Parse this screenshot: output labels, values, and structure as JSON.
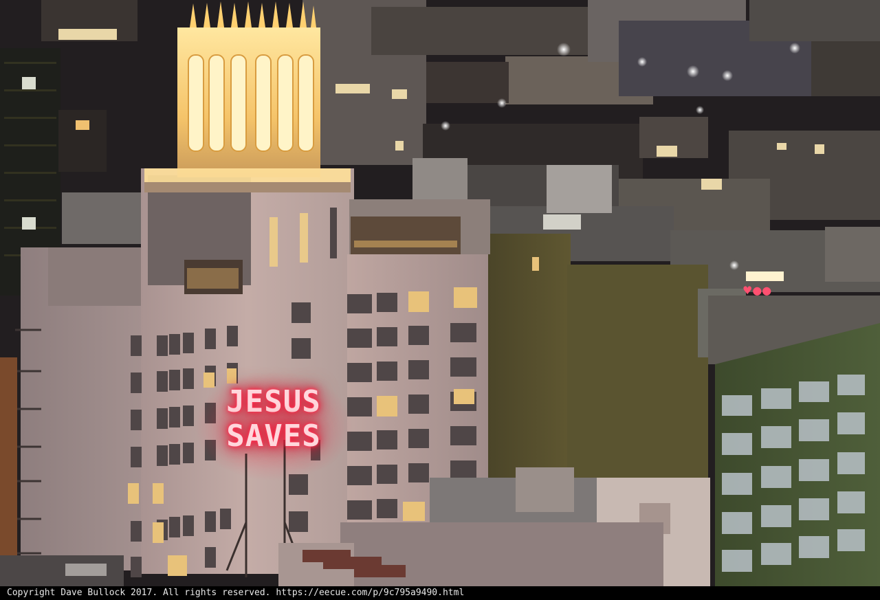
{
  "photo": {
    "neon_sign": {
      "line1": "JESUS",
      "line2": "SAVES",
      "color": "#ff2a4a"
    },
    "colors": {
      "sky_haze": "#1c1a1c",
      "tower_wall": "#c2a9a4",
      "tower_glow": "#ffcf6a",
      "green_building": "#4a5a36",
      "olive_building": "#5d5530"
    }
  },
  "footer": {
    "credit": "Copyright Dave Bullock 2017. All rights reserved. https://eecue.com/p/9c795a9490.html"
  }
}
